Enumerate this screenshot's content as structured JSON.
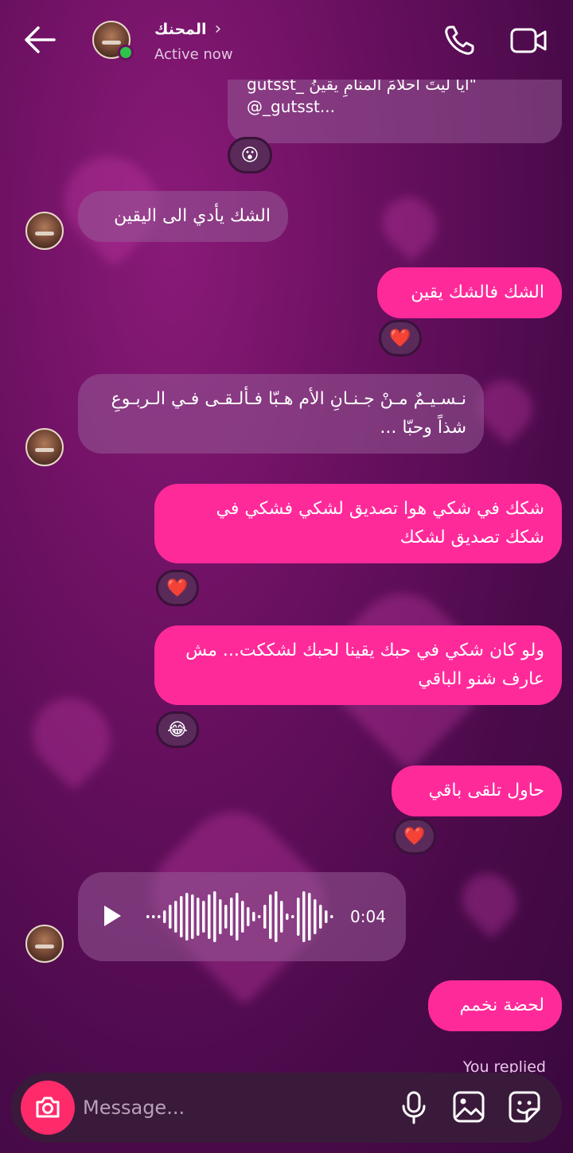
{
  "header": {
    "title": "المحنك",
    "status": "Active now"
  },
  "reply_preview": {
    "line1": "\"ايا ليتَ احلامَ المنامِ يقينُ _gutsst",
    "line2": "@_gutsst..."
  },
  "messages": [
    {
      "id": "m1",
      "direction": "incoming",
      "text": "الشك يأدي الى اليقين"
    },
    {
      "id": "m2",
      "direction": "outgoing",
      "text": "الشك فالشك يقين",
      "reaction": "❤️"
    },
    {
      "id": "m3",
      "direction": "incoming",
      "text": "نـسـيـمٌ مـنْ جـنـانِ الأم هـبّا فـألـقـى فـي الـربـوعِ شذاً وحبّا ..."
    },
    {
      "id": "m4",
      "direction": "outgoing",
      "text": "شكك في شكي هوا تصديق لشكي فشكي في شكك تصديق لشكك",
      "reaction": "❤️"
    },
    {
      "id": "m5",
      "direction": "outgoing",
      "text": "ولو كان شكي في حبك يقينا لحبك لشككت... مش عارف شنو الباقي",
      "reaction": "😂"
    },
    {
      "id": "m6",
      "direction": "outgoing",
      "text": "حاول تلقى باقي",
      "reaction": "❤️"
    },
    {
      "id": "m7",
      "direction": "incoming",
      "type": "voice",
      "duration": "0:04"
    },
    {
      "id": "m8",
      "direction": "outgoing",
      "text": "لحضة نخمم"
    }
  ],
  "reply_reaction": "😮",
  "footer_note": "You replied",
  "composer": {
    "placeholder": "Message..."
  },
  "colors": {
    "outgoing_bubble": "#ff2a9a",
    "online": "#2ec44a",
    "camera_button": "#ff2a6a"
  }
}
